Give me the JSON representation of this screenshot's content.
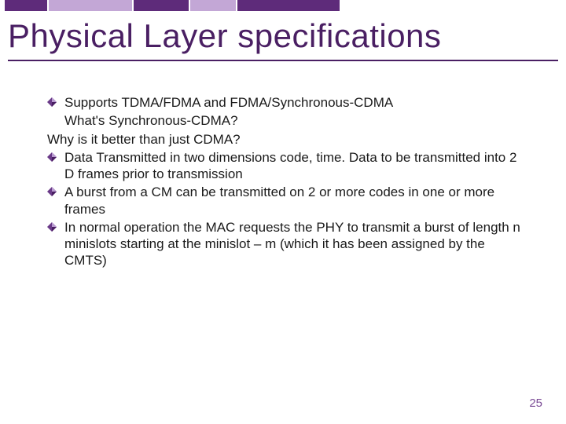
{
  "title": "Physical Layer specifications",
  "bullets": {
    "b0": "Supports TDMA/FDMA and FDMA/Synchronous-CDMA",
    "sub0": "What's Synchronous-CDMA?",
    "sub1": "Why is it better than just CDMA?",
    "b1": "Data Transmitted in two dimensions code, time. Data to be transmitted into 2 D frames prior to transmission",
    "b2": "A burst from a CM can be transmitted on 2 or more codes in one or more frames",
    "b3": "In normal operation the MAC requests the PHY to transmit a burst of length n minislots starting at the minislot – m (which it has been assigned by the CMTS)"
  },
  "page_number": "25",
  "colors": {
    "accent_dark": "#5e2b7a",
    "accent_light": "#c3a7d6",
    "title": "#4a1f63"
  }
}
